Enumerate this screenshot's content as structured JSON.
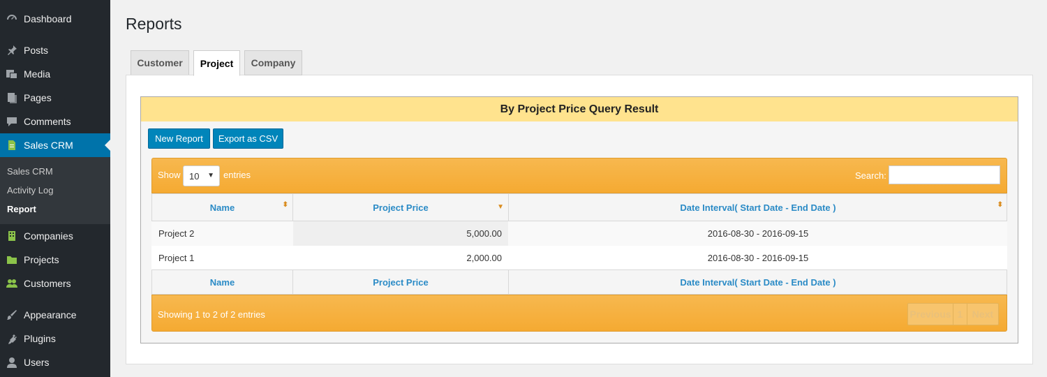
{
  "sidebar": {
    "items": [
      {
        "label": "Dashboard",
        "icon": "dashboard-icon"
      },
      {
        "label": "Posts",
        "icon": "pin-icon"
      },
      {
        "label": "Media",
        "icon": "media-icon"
      },
      {
        "label": "Pages",
        "icon": "pages-icon"
      },
      {
        "label": "Comments",
        "icon": "comment-icon"
      },
      {
        "label": "Sales CRM",
        "icon": "document-icon"
      },
      {
        "label": "Companies",
        "icon": "building-icon"
      },
      {
        "label": "Projects",
        "icon": "folder-icon"
      },
      {
        "label": "Customers",
        "icon": "group-icon"
      },
      {
        "label": "Appearance",
        "icon": "brush-icon"
      },
      {
        "label": "Plugins",
        "icon": "plug-icon"
      },
      {
        "label": "Users",
        "icon": "user-icon"
      }
    ],
    "submenu": [
      "Sales CRM",
      "Activity Log",
      "Report"
    ]
  },
  "page": {
    "title": "Reports",
    "tabs": [
      "Customer",
      "Project",
      "Company"
    ]
  },
  "result": {
    "heading": "By Project Price Query Result",
    "new_report": "New Report",
    "export_csv": "Export as CSV"
  },
  "table": {
    "show": "Show",
    "entries_value": "10",
    "entries": "entries",
    "search": "Search:",
    "columns": [
      "Name",
      "Project Price",
      "Date Interval( Start Date - End Date )"
    ],
    "rows": [
      {
        "name": "Project 2",
        "price": "5,000.00",
        "interval": "2016-08-30 - 2016-09-15"
      },
      {
        "name": "Project 1",
        "price": "2,000.00",
        "interval": "2016-08-30 - 2016-09-15"
      }
    ],
    "info": "Showing 1 to 2 of 2 entries",
    "pager": {
      "previous": "Previous",
      "page": "1",
      "next": "Next"
    }
  },
  "colors": {
    "accent": "#0073aa",
    "orange": "#f5aa32",
    "header_yellow": "#ffe38e"
  }
}
